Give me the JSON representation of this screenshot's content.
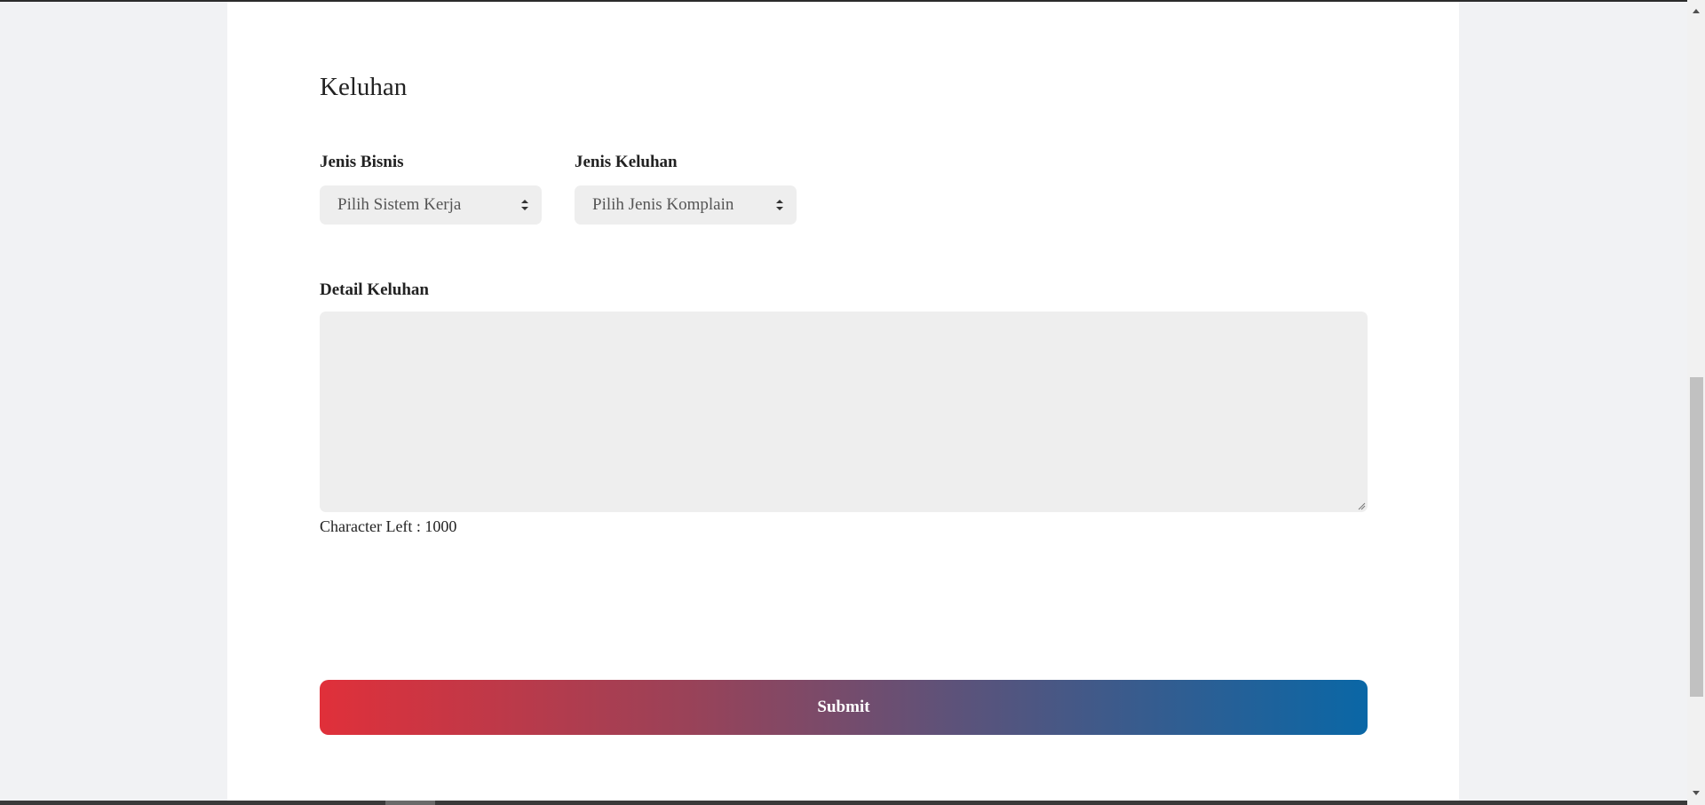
{
  "form": {
    "title": "Keluhan",
    "jenis_bisnis": {
      "label": "Jenis Bisnis",
      "selected": "Pilih Sistem Kerja"
    },
    "jenis_keluhan": {
      "label": "Jenis Keluhan",
      "selected": "Pilih Jenis Komplain"
    },
    "detail": {
      "label": "Detail Keluhan",
      "value": "",
      "char_left_text": "Character Left : 1000"
    },
    "submit_label": "Submit"
  },
  "colors": {
    "submit_gradient_start": "#e0303a",
    "submit_gradient_end": "#0a67a6",
    "field_background": "#eeeeee",
    "page_background": "#f1f2f4"
  },
  "icons": {
    "select_arrows": "up-down-caret-icon",
    "resize_grip": "resize-grip-icon",
    "scroll_up": "scroll-up-arrow-icon",
    "scroll_down": "scroll-down-arrow-icon"
  }
}
